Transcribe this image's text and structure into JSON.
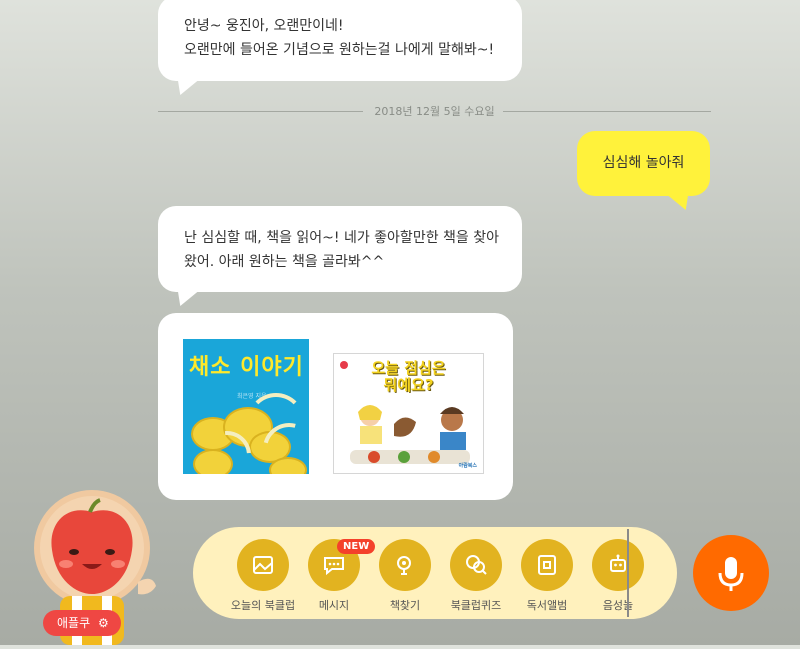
{
  "chat": {
    "bot_message_1": {
      "line1": "안녕~ 웅진아, 오랜만이네!",
      "line2": "오랜만에 들어온 기념으로 원하는걸 나에게 말해봐~!"
    },
    "date_divider": "2018년 12월 5일 수요일",
    "user_message": "심심해 놀아줘",
    "bot_message_2": {
      "line1": "난 심심할 때, 책을 읽어~! 네가 좋아할만한 책을 찾아",
      "line2": "왔어. 아래 원하는 책을 골라봐^^"
    },
    "books": [
      {
        "title": "채소 이야기",
        "author": "최은영 지음"
      },
      {
        "title_line1": "오늘 점심은",
        "title_line2": "뭐예요?",
        "publisher": "아람북스"
      }
    ]
  },
  "dock": {
    "items": [
      {
        "label": "오늘의 북클럽",
        "icon": "book-envelope-icon"
      },
      {
        "label": "메시지",
        "icon": "message-bubble-icon",
        "badge": "NEW"
      },
      {
        "label": "책찾기",
        "icon": "search-book-icon"
      },
      {
        "label": "북클럽퀴즈",
        "icon": "quiz-search-icon"
      },
      {
        "label": "독서앨범",
        "icon": "album-icon"
      },
      {
        "label": "음성놀",
        "icon": "robot-icon"
      }
    ]
  },
  "mascot": {
    "name": "애플쿠",
    "settings_icon": "gear-icon"
  },
  "mic": {
    "icon": "microphone-icon"
  },
  "colors": {
    "accent_yellow_bubble": "#fff23b",
    "dock_bg": "#fff1bd",
    "dock_icon": "#e2b320",
    "mic": "#ff6a00",
    "badge": "#f4412b"
  }
}
